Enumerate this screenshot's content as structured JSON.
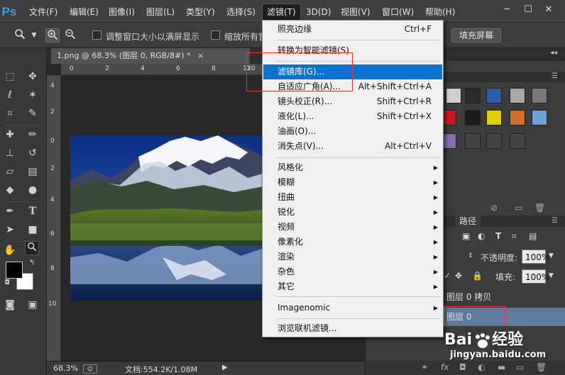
{
  "app": {
    "logo": "Ps"
  },
  "menubar": {
    "items": [
      "文件(F)",
      "编辑(E)",
      "图像(I)",
      "图层(L)",
      "类型(Y)",
      "选择(S)",
      "滤镜(T)",
      "3D(D)",
      "视图(V)",
      "窗口(W)",
      "帮助(H)"
    ],
    "window_buttons": [
      "─",
      "☐",
      "✕"
    ]
  },
  "options_bar": {
    "resize_windows_label": "调整窗口大小以满屏显示",
    "zoom_all_label": "缩放所有窗",
    "fill_screen_button": "填充屏幕"
  },
  "document": {
    "tab_title": "1.png @ 68.3% (图层 0, RGB/8#) *",
    "tab_close": "×",
    "ruler_top_nums": [
      "0",
      "2",
      "4",
      "6",
      "8",
      "10",
      "12"
    ],
    "ruler_left_nums": [
      "4",
      "2",
      "0",
      "2",
      "4",
      "6",
      "8",
      "10"
    ],
    "zoom_level": "68.3%",
    "doc_info": "文档:554.2K/1.08M"
  },
  "filter_menu": {
    "last_filter": {
      "label": "照亮边缘",
      "shortcut": "Ctrl+F"
    },
    "convert_smart": "转换为智能滤镜(S)",
    "items_a": [
      {
        "label": "滤镜库(G)...",
        "shortcut": "",
        "highlighted": true
      },
      {
        "label": "自适应广角(A)...",
        "shortcut": "Alt+Shift+Ctrl+A"
      },
      {
        "label": "镜头校正(R)...",
        "shortcut": "Shift+Ctrl+R"
      },
      {
        "label": "液化(L)...",
        "shortcut": "Shift+Ctrl+X"
      },
      {
        "label": "油画(O)...",
        "shortcut": ""
      },
      {
        "label": "消失点(V)...",
        "shortcut": "Alt+Ctrl+V"
      }
    ],
    "submenus": [
      "风格化",
      "模糊",
      "扭曲",
      "锐化",
      "视频",
      "像素化",
      "渲染",
      "杂色",
      "其它"
    ],
    "imagenomic": "Imagenomic",
    "browse_online": "浏览联机滤镜..."
  },
  "right_panel": {
    "paths_tab": "路径",
    "opacity_label": "不透明度:",
    "opacity_value": "100%",
    "fill_label": "填充:",
    "fill_value": "100%",
    "layers": [
      "图层 0 拷贝",
      "图层 0"
    ],
    "styles_swatches": [
      "#cfcfcf",
      "#2b2b2b",
      "#2a5ea8",
      "#a8a8a8",
      "#7a7a7a",
      "#cc1a1a",
      "#1a1a1a",
      "#e0d000",
      "#d26e2a",
      "#6fa2d8",
      "#8a6ab0",
      "#444",
      "#444",
      "#444"
    ]
  },
  "watermark": {
    "brand_left": "Bai",
    "brand_right": "经验",
    "paw": "du",
    "url": "jingyan.baidu.com"
  }
}
